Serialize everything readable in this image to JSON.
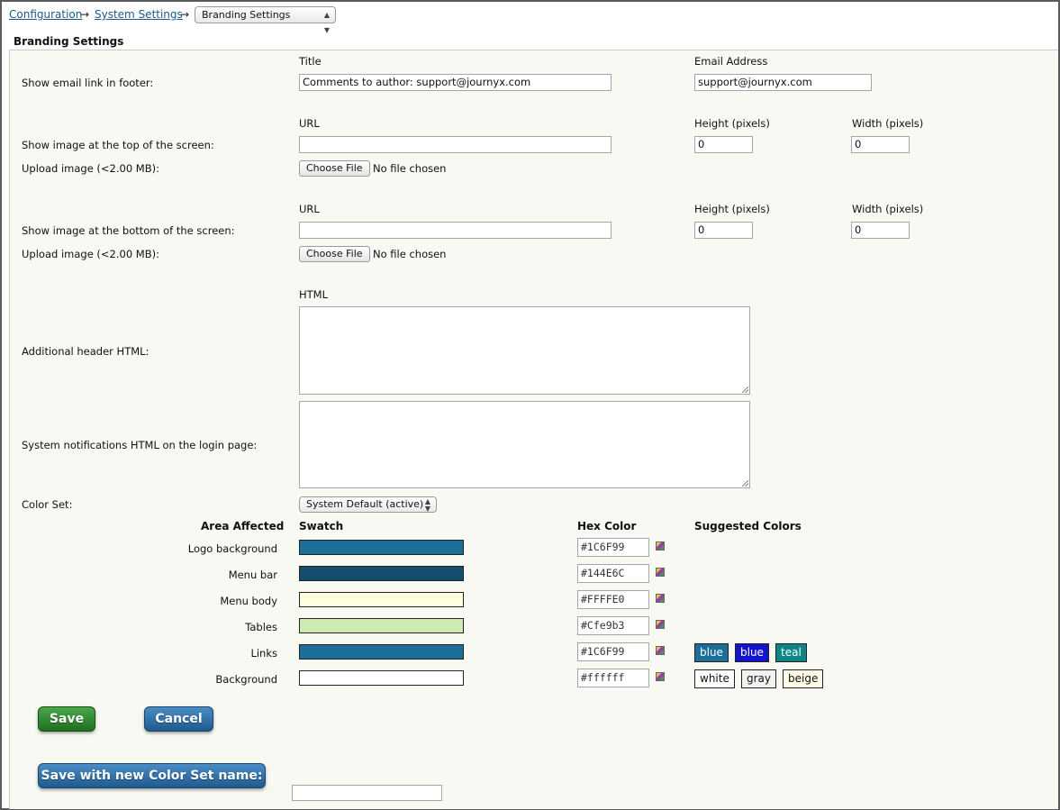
{
  "breadcrumb": {
    "items": [
      "Configuration",
      "System Settings"
    ],
    "separator": "→",
    "current": "Branding Settings"
  },
  "section_title": "Branding Settings",
  "footer_link": {
    "row_label": "Show email link in footer:",
    "title_header": "Title",
    "title_value": "Comments to author: support@journyx.com",
    "email_header": "Email Address",
    "email_value": "support@journyx.com"
  },
  "top_image": {
    "url_header": "URL",
    "height_header": "Height (pixels)",
    "width_header": "Width (pixels)",
    "row_label": "Show image at the top of the screen:",
    "url_value": "",
    "height_value": "0",
    "width_value": "0",
    "upload_label": "Upload image (<2.00 MB):",
    "choose_label": "Choose File",
    "no_file": "No file chosen"
  },
  "bottom_image": {
    "url_header": "URL",
    "height_header": "Height (pixels)",
    "width_header": "Width (pixels)",
    "row_label": "Show image at the bottom of the screen:",
    "url_value": "",
    "height_value": "0",
    "width_value": "0",
    "upload_label": "Upload image (<2.00 MB):",
    "choose_label": "Choose File",
    "no_file": "No file chosen"
  },
  "html_header": "HTML",
  "header_html_label": "Additional header HTML:",
  "notifications_label": "System notifications HTML on the login page:",
  "color_set": {
    "label": "Color Set:",
    "selected": "System Default (active)"
  },
  "color_table": {
    "headers": {
      "area": "Area Affected",
      "swatch": "Swatch",
      "hex": "Hex Color",
      "suggested": "Suggested Colors"
    },
    "rows": [
      {
        "area": "Logo background",
        "color": "#1C6F99",
        "hex": "#1C6F99"
      },
      {
        "area": "Menu bar",
        "color": "#144E6C",
        "hex": "#144E6C"
      },
      {
        "area": "Menu body",
        "color": "#FFFFE0",
        "hex": "#FFFFE0"
      },
      {
        "area": "Tables",
        "color": "#CFE9B3",
        "hex": "#Cfe9b3"
      },
      {
        "area": "Links",
        "color": "#1C6F99",
        "hex": "#1C6F99"
      },
      {
        "area": "Background",
        "color": "#FFFFFF",
        "hex": "#ffffff"
      }
    ],
    "suggested_links": [
      {
        "label": "blue",
        "color": "#1C6F99",
        "text_color": "#ffffff"
      },
      {
        "label": "blue",
        "color": "#1414CC",
        "text_color": "#ffffff"
      },
      {
        "label": "teal",
        "color": "#0E8585",
        "text_color": "#ffffff"
      }
    ],
    "suggested_background": [
      {
        "label": "white",
        "color": "#FFFFFF",
        "text_color": "#111111"
      },
      {
        "label": "gray",
        "color": "#F2F2F2",
        "text_color": "#111111"
      },
      {
        "label": "beige",
        "color": "#FFFDE8",
        "text_color": "#111111"
      }
    ]
  },
  "actions": {
    "save": "Save",
    "cancel": "Cancel",
    "save_new": "Save with new Color Set name:",
    "new_name_value": ""
  }
}
